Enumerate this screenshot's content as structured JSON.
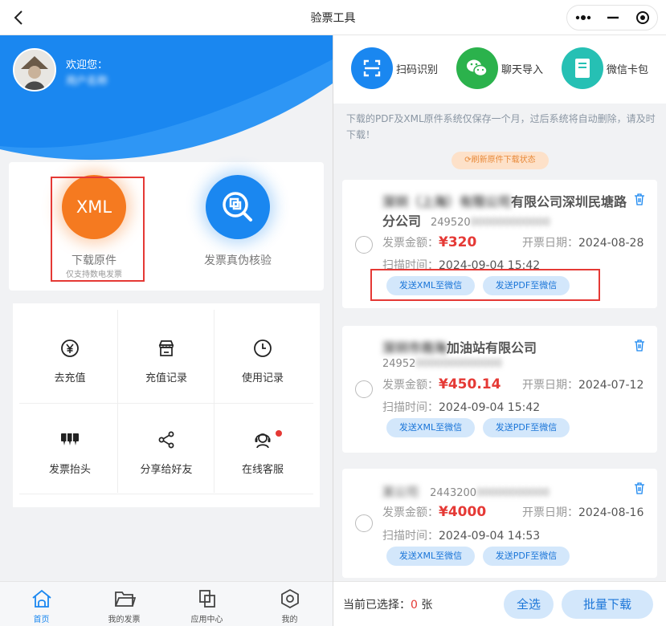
{
  "window": {
    "title": "验票工具"
  },
  "user": {
    "welcome": "欢迎您：",
    "name": "用户名称"
  },
  "main_actions": {
    "xml_label": "XML",
    "download_label": "下载原件",
    "download_sub": "仅支持数电发票",
    "verify_label": "发票真伪核验"
  },
  "grid": [
    {
      "label": "去充值",
      "icon": "yuan-icon"
    },
    {
      "label": "充值记录",
      "icon": "store-icon"
    },
    {
      "label": "使用记录",
      "icon": "clock-icon"
    },
    {
      "label": "发票抬头",
      "icon": "header-icon"
    },
    {
      "label": "分享给好友",
      "icon": "share-icon"
    },
    {
      "label": "在线客服",
      "icon": "support-icon"
    }
  ],
  "tabs": [
    {
      "label": "首页",
      "icon": "home-icon"
    },
    {
      "label": "我的发票",
      "icon": "folder-icon"
    },
    {
      "label": "应用中心",
      "icon": "apps-icon"
    },
    {
      "label": "我的",
      "icon": "user-hex-icon"
    }
  ],
  "tools": [
    {
      "label": "扫码识别",
      "icon": "scan-icon",
      "color": "#1a87f0"
    },
    {
      "label": "聊天导入",
      "icon": "wechat-icon",
      "color": "#2bb24c"
    },
    {
      "label": "微信卡包",
      "icon": "card-icon",
      "color": "#26c0b4"
    }
  ],
  "notice": "下载的PDF及XML原件系统仅保存一个月，过后系统将自动删除，请及时下载！",
  "refresh_label": "⟳刷新原件下载状态",
  "field_labels": {
    "amount": "发票金额：",
    "issue_date": "开票日期：",
    "scan_time": "扫描时间：",
    "currency": "¥",
    "send_xml": "发送XML至微信",
    "send_pdf": "发送PDF至微信"
  },
  "invoices": [
    {
      "company_hidden": "深圳（上海）有限公司",
      "company_visible": "有限公司深圳民塘路",
      "company_line2": "分公司",
      "tax_prefix": "249520",
      "tax_hidden": "000000000000",
      "amount": "320",
      "issue_date": "2024-08-28",
      "scan_time": "2024-09-04 15:42"
    },
    {
      "company_hidden": "深圳市南海",
      "company_visible": "加油站有限公司",
      "tax_prefix": "24952",
      "tax_hidden": "0000000000000",
      "amount": "450.14",
      "issue_date": "2024-07-12",
      "scan_time": "2024-09-04 15:42"
    },
    {
      "company_hidden": "某公司",
      "tax_prefix": "2443200",
      "tax_hidden": "00000000000",
      "amount": "4000",
      "issue_date": "2024-08-16",
      "scan_time": "2024-09-04 14:53"
    }
  ],
  "bottom": {
    "selected_prefix": "当前已选择：",
    "selected_count": "0",
    "selected_unit": " 张",
    "select_all": "全选",
    "batch_download": "批量下载"
  },
  "colors": {
    "primary": "#1a87f0",
    "orange": "#f57a20",
    "danger": "#e53935"
  }
}
